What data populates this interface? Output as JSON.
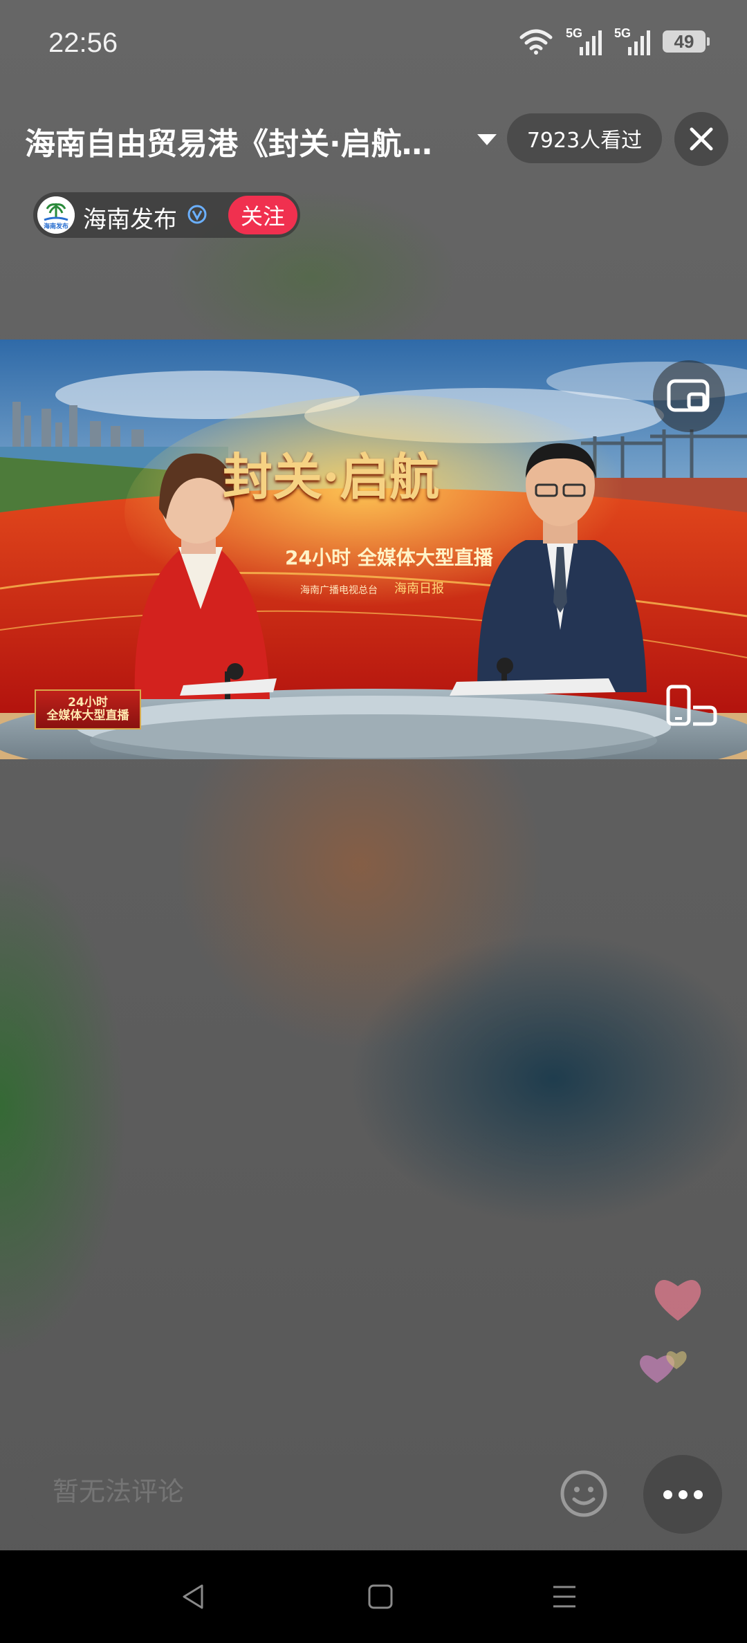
{
  "status_bar": {
    "time": "22:56",
    "signal1_label": "5G",
    "signal2_label": "5G",
    "battery": "49",
    "icons": [
      "wifi-icon",
      "signal-icon",
      "signal-icon",
      "battery-icon"
    ]
  },
  "header": {
    "title": "海南自由贸易港《封关·启航…",
    "viewers": "7923人看过",
    "close_icon": "close-icon",
    "dropdown_icon": "caret-down-icon"
  },
  "publisher": {
    "name": "海南发布",
    "avatar_text": "海南发布",
    "follow_label": "关注",
    "verified_icon": "verified-icon"
  },
  "video": {
    "banner_title": "封关·启航",
    "banner_subtitle": "24小时 全媒体大型直播",
    "org_1": "海南广播电视总台",
    "org_2": "海南日报",
    "corner_logo_line1": "24小时",
    "corner_logo_line2": "全媒体大型直播",
    "pip_icon": "picture-in-picture-icon",
    "rotate_icon": "rotate-screen-icon"
  },
  "comment": {
    "placeholder": "暂无法评论",
    "emoji_icon": "emoji-icon",
    "more_icon": "more-icon"
  },
  "nav": {
    "back_icon": "back-icon",
    "home_icon": "home-icon",
    "menu_icon": "menu-icon"
  },
  "colors": {
    "follow": "#f0304f",
    "background": "#5f5f5f",
    "nav_bar": "#000000"
  }
}
